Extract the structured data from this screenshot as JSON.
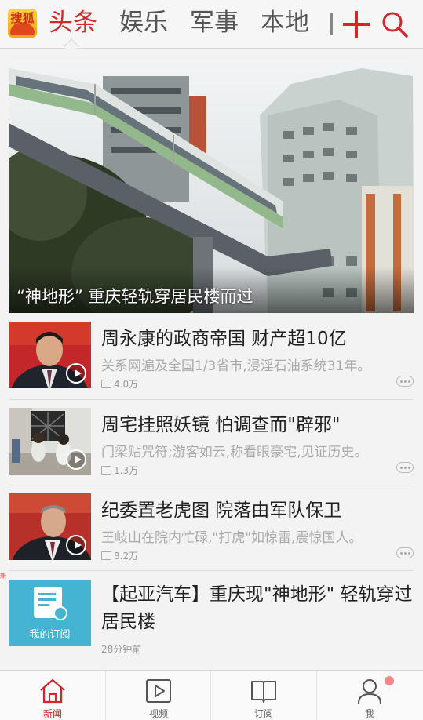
{
  "header": {
    "logo_text": "搜狐",
    "tabs": [
      {
        "label": "头条",
        "active": true
      },
      {
        "label": "娱乐",
        "active": false
      },
      {
        "label": "军事",
        "active": false
      },
      {
        "label": "本地",
        "active": false
      }
    ],
    "add_icon": "plus-icon",
    "search_icon": "search-icon",
    "accent_color": "#d4262c"
  },
  "hero": {
    "caption": "“神地形” 重庆轻轨穿居民楼而过"
  },
  "news": [
    {
      "title": "周永康的政商帝国 财产超10亿",
      "desc": "关系网遍及全国1/3省市,浸淫石油系统31年。",
      "comments": "4.0万",
      "has_video": true
    },
    {
      "title": "周宅挂照妖镜 怕调查而\"辟邪\"",
      "desc": "门梁贴咒符;游客如云,称看眼豪宅,见证历史。",
      "comments": "1.3万",
      "has_video": true
    },
    {
      "title": "纪委置老虎图 院落由军队保卫",
      "desc": "王岐山在院内忙碌,\"打虎\"如惊雷,震惊国人。",
      "comments": "8.2万",
      "has_video": true
    }
  ],
  "ad": {
    "badge": "新",
    "thumb_label": "我的订阅",
    "title": "【起亚汽车】重庆现\"神地形\" 轻轨穿过 居民楼",
    "time": "28分钟前"
  },
  "bottom_nav": [
    {
      "label": "新闻",
      "icon": "home-icon",
      "active": true
    },
    {
      "label": "视频",
      "icon": "video-icon",
      "active": false
    },
    {
      "label": "订阅",
      "icon": "book-icon",
      "active": false
    },
    {
      "label": "我",
      "icon": "user-icon",
      "active": false
    }
  ]
}
